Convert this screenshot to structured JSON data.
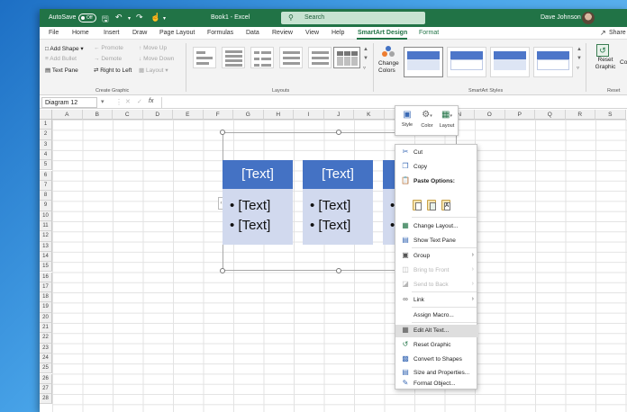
{
  "titlebar": {
    "autosave_label": "AutoSave",
    "autosave_state": "Off",
    "doc_title": "Book1  -  Excel",
    "search_placeholder": "Search",
    "user_name": "Dave Johnson"
  },
  "tabs": [
    "File",
    "Home",
    "Insert",
    "Draw",
    "Page Layout",
    "Formulas",
    "Data",
    "Review",
    "View",
    "Help",
    "SmartArt Design",
    "Format"
  ],
  "active_tab": "SmartArt Design",
  "share_label": "Share",
  "ribbon": {
    "create_graphic": {
      "add_shape": "Add Shape",
      "add_bullet": "Add Bullet",
      "text_pane": "Text Pane",
      "promote": "Promote",
      "demote": "Demote",
      "right_to_left": "Right to Left",
      "move_up": "Move Up",
      "move_down": "Move Down",
      "layout": "Layout",
      "group_label": "Create Graphic"
    },
    "layouts_label": "Layouts",
    "change_colors": "Change Colors",
    "smartart_styles_label": "SmartArt Styles",
    "reset_graphic": "Reset Graphic",
    "convert_partial": "Co",
    "reset_label": "Reset"
  },
  "formula_bar": {
    "name_box": "Diagram 12",
    "fx": "fx"
  },
  "columns": [
    "A",
    "B",
    "C",
    "D",
    "E",
    "F",
    "G",
    "H",
    "I",
    "J",
    "K",
    "L",
    "M",
    "N",
    "O",
    "P",
    "Q",
    "R",
    "S"
  ],
  "rows": [
    "1",
    "2",
    "3",
    "4",
    "5",
    "6",
    "7",
    "8",
    "9",
    "10",
    "11",
    "12",
    "13",
    "14",
    "15",
    "16",
    "17",
    "18",
    "19",
    "20",
    "21",
    "22",
    "23",
    "24",
    "25",
    "26",
    "27",
    "28"
  ],
  "smartart": {
    "head_text": "[Text]",
    "bullet_text": "[Text]"
  },
  "mini_toolbar": {
    "style": "Style",
    "color": "Color",
    "layout": "Layout"
  },
  "context_menu": {
    "cut": "Cut",
    "copy": "Copy",
    "paste_options": "Paste Options:",
    "change_layout": "Change Layout...",
    "show_text_pane": "Show Text Pane",
    "group": "Group",
    "bring_to_front": "Bring to Front",
    "send_to_back": "Send to Back",
    "link": "Link",
    "assign_macro": "Assign Macro...",
    "edit_alt_text": "Edit Alt Text...",
    "reset_graphic": "Reset Graphic",
    "convert_to_shapes": "Convert to Shapes",
    "size_and_properties": "Size and Properties...",
    "format_object": "Format Object..."
  },
  "colors": {
    "excel_green": "#217346",
    "smartart_blue": "#4472c4",
    "smartart_light": "#d1d9ee"
  }
}
